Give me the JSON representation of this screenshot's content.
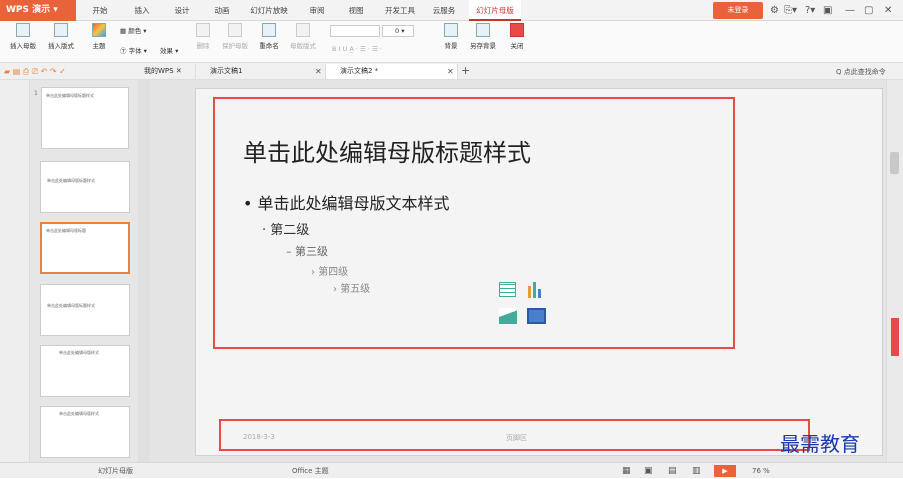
{
  "app": {
    "name": "WPS 演示",
    "login_label": "未登录"
  },
  "menu": [
    "开始",
    "插入",
    "设计",
    "动画",
    "幻灯片放映",
    "审阅",
    "视图",
    "开发工具",
    "云服务",
    "幻灯片母版"
  ],
  "window_controls": {
    "restore": "▣",
    "minimize": "—",
    "maximize": "▢",
    "close": "✕"
  },
  "ribbon": {
    "insert_master": "插入母版",
    "insert_layout": "插入版式",
    "theme": "主题",
    "colors": "颜色",
    "fonts": "字体",
    "effects": "效果",
    "delete": "删除",
    "protect_master": "保护母版",
    "rename": "重命名",
    "master_layout": "母版版式",
    "font_size_value": "0",
    "background": "背景",
    "save_background": "另存背景",
    "close": "关闭"
  },
  "tabs": [
    {
      "label": "我的WPS"
    },
    {
      "label": "演示文稿1"
    },
    {
      "label": "演示文稿2 *"
    }
  ],
  "search_placeholder": "点此查找命令",
  "slide": {
    "title": "单击此处编辑母版标题样式",
    "level1": "单击此处编辑母版文本样式",
    "level2": "第二级",
    "level3": "第三级",
    "level4": "第四级",
    "level5": "第五级",
    "footer_date": "2018-3-3",
    "footer_text": "页脚区"
  },
  "thumbnails": [
    {
      "num": "1",
      "title": "单击此处编辑母版标题样式"
    },
    {
      "num": "",
      "title": "单击此处编辑母版标题样式"
    },
    {
      "num": "",
      "title": "单击此处编辑母版标题"
    },
    {
      "num": "",
      "title": "单击此处编辑母版标题样式"
    },
    {
      "num": "",
      "title": "单击此处编辑母版样式"
    },
    {
      "num": "",
      "title": "单击此处编辑母版样式"
    }
  ],
  "status": {
    "view": "幻灯片母版",
    "theme": "Office 主题",
    "zoom": "76 %"
  },
  "watermark": "最需教育",
  "colors": {
    "accent": "#e8633a",
    "highlight": "#e84a4a"
  }
}
